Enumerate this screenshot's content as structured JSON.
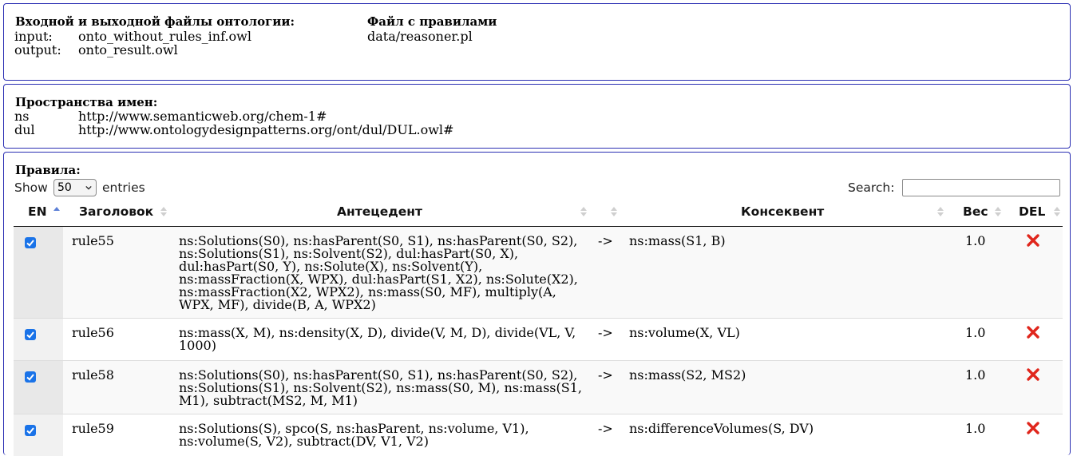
{
  "files": {
    "heading": "Входной и выходной файлы онтологии:",
    "input_label": "input:",
    "input_value": "onto_without_rules_inf.owl",
    "output_label": "output:",
    "output_value": "onto_result.owl",
    "rules_heading": "Файл с правилами",
    "rules_value": "data/reasoner.pl"
  },
  "namespaces": {
    "heading": "Пространства имен:",
    "items": [
      {
        "prefix": "ns",
        "uri": "http://www.semanticweb.org/chem-1#"
      },
      {
        "prefix": "dul",
        "uri": "http://www.ontologydesignpatterns.org/ont/dul/DUL.owl#"
      }
    ]
  },
  "rules_panel": {
    "heading": "Правила:",
    "show_label": "Show",
    "entries_value": "50",
    "entries_label": "entries",
    "search_label": "Search:",
    "search_value": ""
  },
  "table": {
    "columns": [
      "EN",
      "Заголовок",
      "Антецедент",
      "",
      "Консеквент",
      "Вес",
      "DEL"
    ],
    "rows": [
      {
        "enabled": true,
        "title": "rule55",
        "antecedent": "ns:Solutions(S0), ns:hasParent(S0, S1), ns:hasParent(S0, S2), ns:Solutions(S1), ns:Solvent(S2), dul:hasPart(S0, X), dul:hasPart(S0, Y), ns:Solute(X), ns:Solvent(Y), ns:massFraction(X, WPX), dul:hasPart(S1, X2), ns:Solute(X2), ns:massFraction(X2, WPX2), ns:mass(S0, MF), multiply(A, WPX, MF), divide(B, A, WPX2)",
        "arrow": "->",
        "consequent": "ns:mass(S1, B)",
        "weight": "1.0"
      },
      {
        "enabled": true,
        "title": "rule56",
        "antecedent": "ns:mass(X, M), ns:density(X, D), divide(V, M, D), divide(VL, V, 1000)",
        "arrow": "->",
        "consequent": "ns:volume(X, VL)",
        "weight": "1.0"
      },
      {
        "enabled": true,
        "title": "rule58",
        "antecedent": "ns:Solutions(S0), ns:hasParent(S0, S1), ns:hasParent(S0, S2), ns:Solutions(S1), ns:Solvent(S2), ns:mass(S0, M), ns:mass(S1, M1), subtract(MS2, M, M1)",
        "arrow": "->",
        "consequent": "ns:mass(S2, MS2)",
        "weight": "1.0"
      },
      {
        "enabled": true,
        "title": "rule59",
        "antecedent": "ns:Solutions(S), spco(S, ns:hasParent, ns:volume, V1), ns:volume(S, V2), subtract(DV, V1, V2)",
        "arrow": "->",
        "consequent": "ns:differenceVolumes(S, DV)",
        "weight": "1.0"
      }
    ]
  },
  "colors": {
    "panel_border": "#2b2fb3",
    "checkbox": "#1a73e8",
    "delete_icon": "#e0261c"
  }
}
